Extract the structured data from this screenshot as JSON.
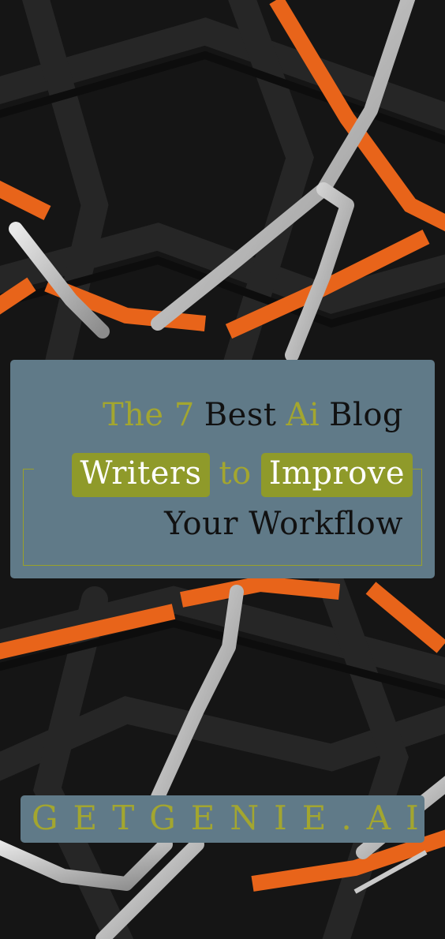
{
  "headline": {
    "part1": "The 7",
    "part2": "Best",
    "part3": "Ai",
    "part4": "Blog",
    "part5": "Writers",
    "part6": "to",
    "part7": "Improve",
    "part8": "Your Workflow"
  },
  "brand": {
    "text": "GETGENIE.AI"
  },
  "colors": {
    "card": "#607a88",
    "olive": "#a3a62f",
    "pill": "#8f9a2a",
    "orange": "#e8641a",
    "background": "#131313"
  }
}
